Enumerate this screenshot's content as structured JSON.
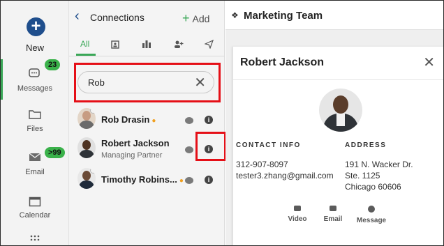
{
  "rail": {
    "new_label": "New",
    "messages": {
      "label": "Messages",
      "badge": "23"
    },
    "files": {
      "label": "Files"
    },
    "email": {
      "label": "Email",
      "badge": ">99"
    },
    "calendar": {
      "label": "Calendar"
    },
    "more_icon": "grid-icon"
  },
  "connections": {
    "title": "Connections",
    "add_label": "Add",
    "tabs": [
      "All",
      "contacts-icon",
      "company-icon",
      "add-person-icon",
      "send-icon"
    ],
    "search": {
      "value": "Rob",
      "clear_icon": "close-icon"
    },
    "contacts": [
      {
        "name": "Rob Drasin",
        "subtitle": "",
        "presence_icon": "presence-icon"
      },
      {
        "name": "Robert Jackson",
        "subtitle": "Managing Partner",
        "presence_icon": ""
      },
      {
        "name": "Timothy Robins...",
        "subtitle": "",
        "presence_icon": "presence-icon"
      }
    ]
  },
  "main": {
    "team_title": "Marketing Team",
    "detail": {
      "name": "Robert Jackson",
      "contact_info_heading": "CONTACT INFO",
      "address_heading": "ADDRESS",
      "phone": "312-907-8097",
      "email": "tester3.zhang@gmail.com",
      "address_line1": "191 N. Wacker Dr.",
      "address_line2": "Ste. 1125",
      "address_line3": "Chicago 60606",
      "actions": [
        "Video",
        "Email",
        "Message"
      ]
    }
  },
  "colors": {
    "accent_green": "#3aa757",
    "brand_blue": "#1f4e8c",
    "highlight_red": "#e50f17"
  }
}
